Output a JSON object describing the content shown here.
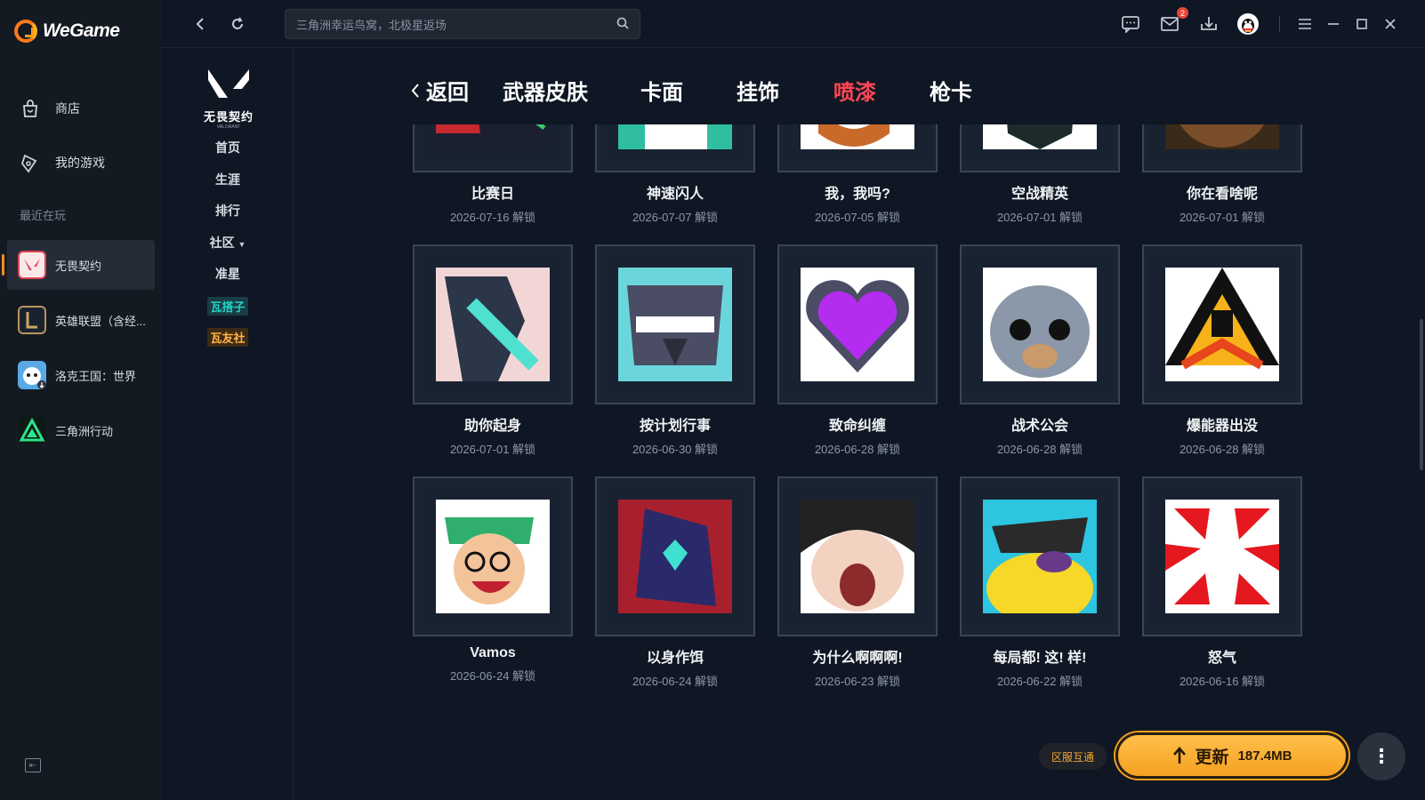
{
  "app": {
    "name": "WeGame"
  },
  "sidebar": {
    "nav": [
      {
        "label": "商店",
        "icon": "store-bag-icon"
      },
      {
        "label": "我的游戏",
        "icon": "gamepad-icon"
      }
    ],
    "recent_label": "最近在玩",
    "games": [
      {
        "label": "无畏契约",
        "icon": "valorant-icon",
        "active": true
      },
      {
        "label": "英雄联盟（含经...",
        "icon": "league-icon"
      },
      {
        "label": "洛克王国：世界",
        "icon": "roco-icon"
      },
      {
        "label": "三角洲行动",
        "icon": "delta-force-icon"
      }
    ]
  },
  "topbar": {
    "search_placeholder": "三角洲幸运鸟窝，北极星返场",
    "mail_badge": "2"
  },
  "subnav": {
    "game_title": "无畏契约",
    "game_subtitle": "VALORANT",
    "items": [
      "首页",
      "生涯",
      "排行",
      "社区",
      "准星"
    ],
    "pill1": "瓦搭子",
    "pill2": "瓦友社"
  },
  "tabs": {
    "back": "返回",
    "items": [
      "武器皮肤",
      "卡面",
      "挂饰",
      "喷漆",
      "枪卡"
    ],
    "active": "喷漆"
  },
  "sprays": [
    {
      "name": "比赛日",
      "date": "2026-07-16 解锁"
    },
    {
      "name": "神速闪人",
      "date": "2026-07-07 解锁"
    },
    {
      "name": "我，我吗?",
      "date": "2026-07-05 解锁"
    },
    {
      "name": "空战精英",
      "date": "2026-07-01 解锁"
    },
    {
      "name": "你在看啥呢",
      "date": "2026-07-01 解锁"
    },
    {
      "name": "助你起身",
      "date": "2026-07-01 解锁"
    },
    {
      "name": "按计划行事",
      "date": "2026-06-30 解锁"
    },
    {
      "name": "致命纠缠",
      "date": "2026-06-28 解锁"
    },
    {
      "name": "战术公会",
      "date": "2026-06-28 解锁"
    },
    {
      "name": "爆能器出没",
      "date": "2026-06-28 解锁"
    },
    {
      "name": "Vamos",
      "date": "2026-06-24 解锁"
    },
    {
      "name": "以身作饵",
      "date": "2026-06-24 解锁"
    },
    {
      "name": "为什么啊啊啊!",
      "date": "2026-06-23 解锁"
    },
    {
      "name": "每局都! 这! 样!",
      "date": "2026-06-22 解锁"
    },
    {
      "name": "怒气",
      "date": "2026-06-16 解锁"
    }
  ],
  "bottom": {
    "region": "区服互通",
    "update_label": "更新",
    "update_size": "187.4MB"
  },
  "colors": {
    "accent": "#ff4655",
    "update": "#f5a020",
    "bg": "#0f1724"
  }
}
